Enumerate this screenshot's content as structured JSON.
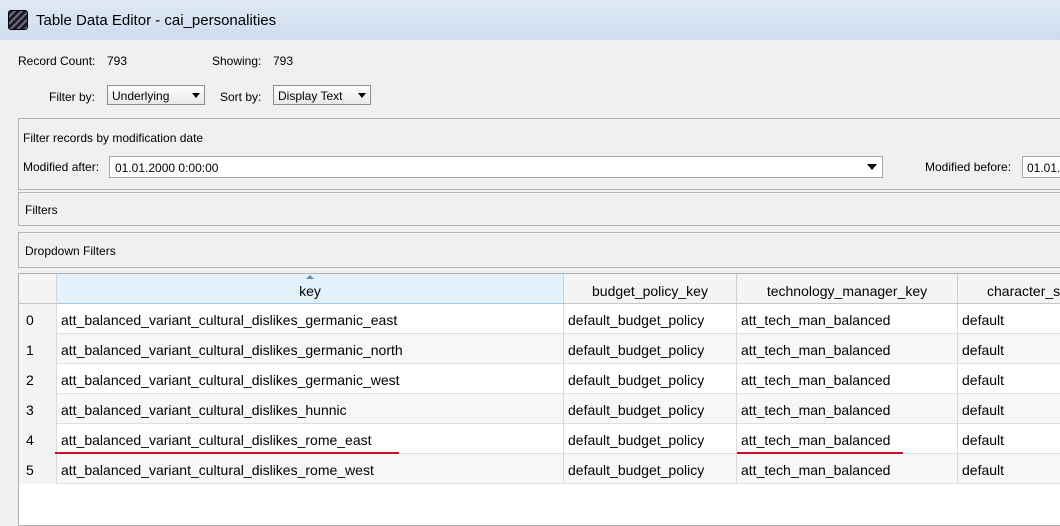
{
  "window": {
    "title": "Table Data Editor - cai_personalities",
    "icon": "table-app-icon"
  },
  "counts": {
    "record_label": "Record Count:",
    "record_value": "793",
    "showing_label": "Showing:",
    "showing_value": "793"
  },
  "controls": {
    "filter_label": "Filter by:",
    "filter_value": "Underlying",
    "sort_label": "Sort by:",
    "sort_value": "Display Text"
  },
  "date_panel": {
    "title": "Filter records by modification date",
    "after_label": "Modified after:",
    "after_value": "01.01.2000 0:00:00",
    "before_label": "Modified before:",
    "before_value": "01.01."
  },
  "filters_panel": {
    "title": "Filters"
  },
  "dropdown_filters_panel": {
    "title": "Dropdown Filters"
  },
  "table": {
    "columns": [
      "",
      "key",
      "budget_policy_key",
      "technology_manager_key",
      "character_s"
    ],
    "rows": [
      {
        "index": "0",
        "key": "att_balanced_variant_cultural_dislikes_germanic_east",
        "budget": "default_budget_policy",
        "tech": "att_tech_man_balanced",
        "char": "default"
      },
      {
        "index": "1",
        "key": "att_balanced_variant_cultural_dislikes_germanic_north",
        "budget": "default_budget_policy",
        "tech": "att_tech_man_balanced",
        "char": "default"
      },
      {
        "index": "2",
        "key": "att_balanced_variant_cultural_dislikes_germanic_west",
        "budget": "default_budget_policy",
        "tech": "att_tech_man_balanced",
        "char": "default"
      },
      {
        "index": "3",
        "key": "att_balanced_variant_cultural_dislikes_hunnic",
        "budget": "default_budget_policy",
        "tech": "att_tech_man_balanced",
        "char": "default"
      },
      {
        "index": "4",
        "key": "att_balanced_variant_cultural_dislikes_rome_east",
        "budget": "default_budget_policy",
        "tech": "att_tech_man_balanced",
        "char": "default"
      },
      {
        "index": "5",
        "key": "att_balanced_variant_cultural_dislikes_rome_west",
        "budget": "default_budget_policy",
        "tech": "att_tech_man_balanced",
        "char": "default"
      }
    ]
  },
  "annotation_color": "#c8102e"
}
